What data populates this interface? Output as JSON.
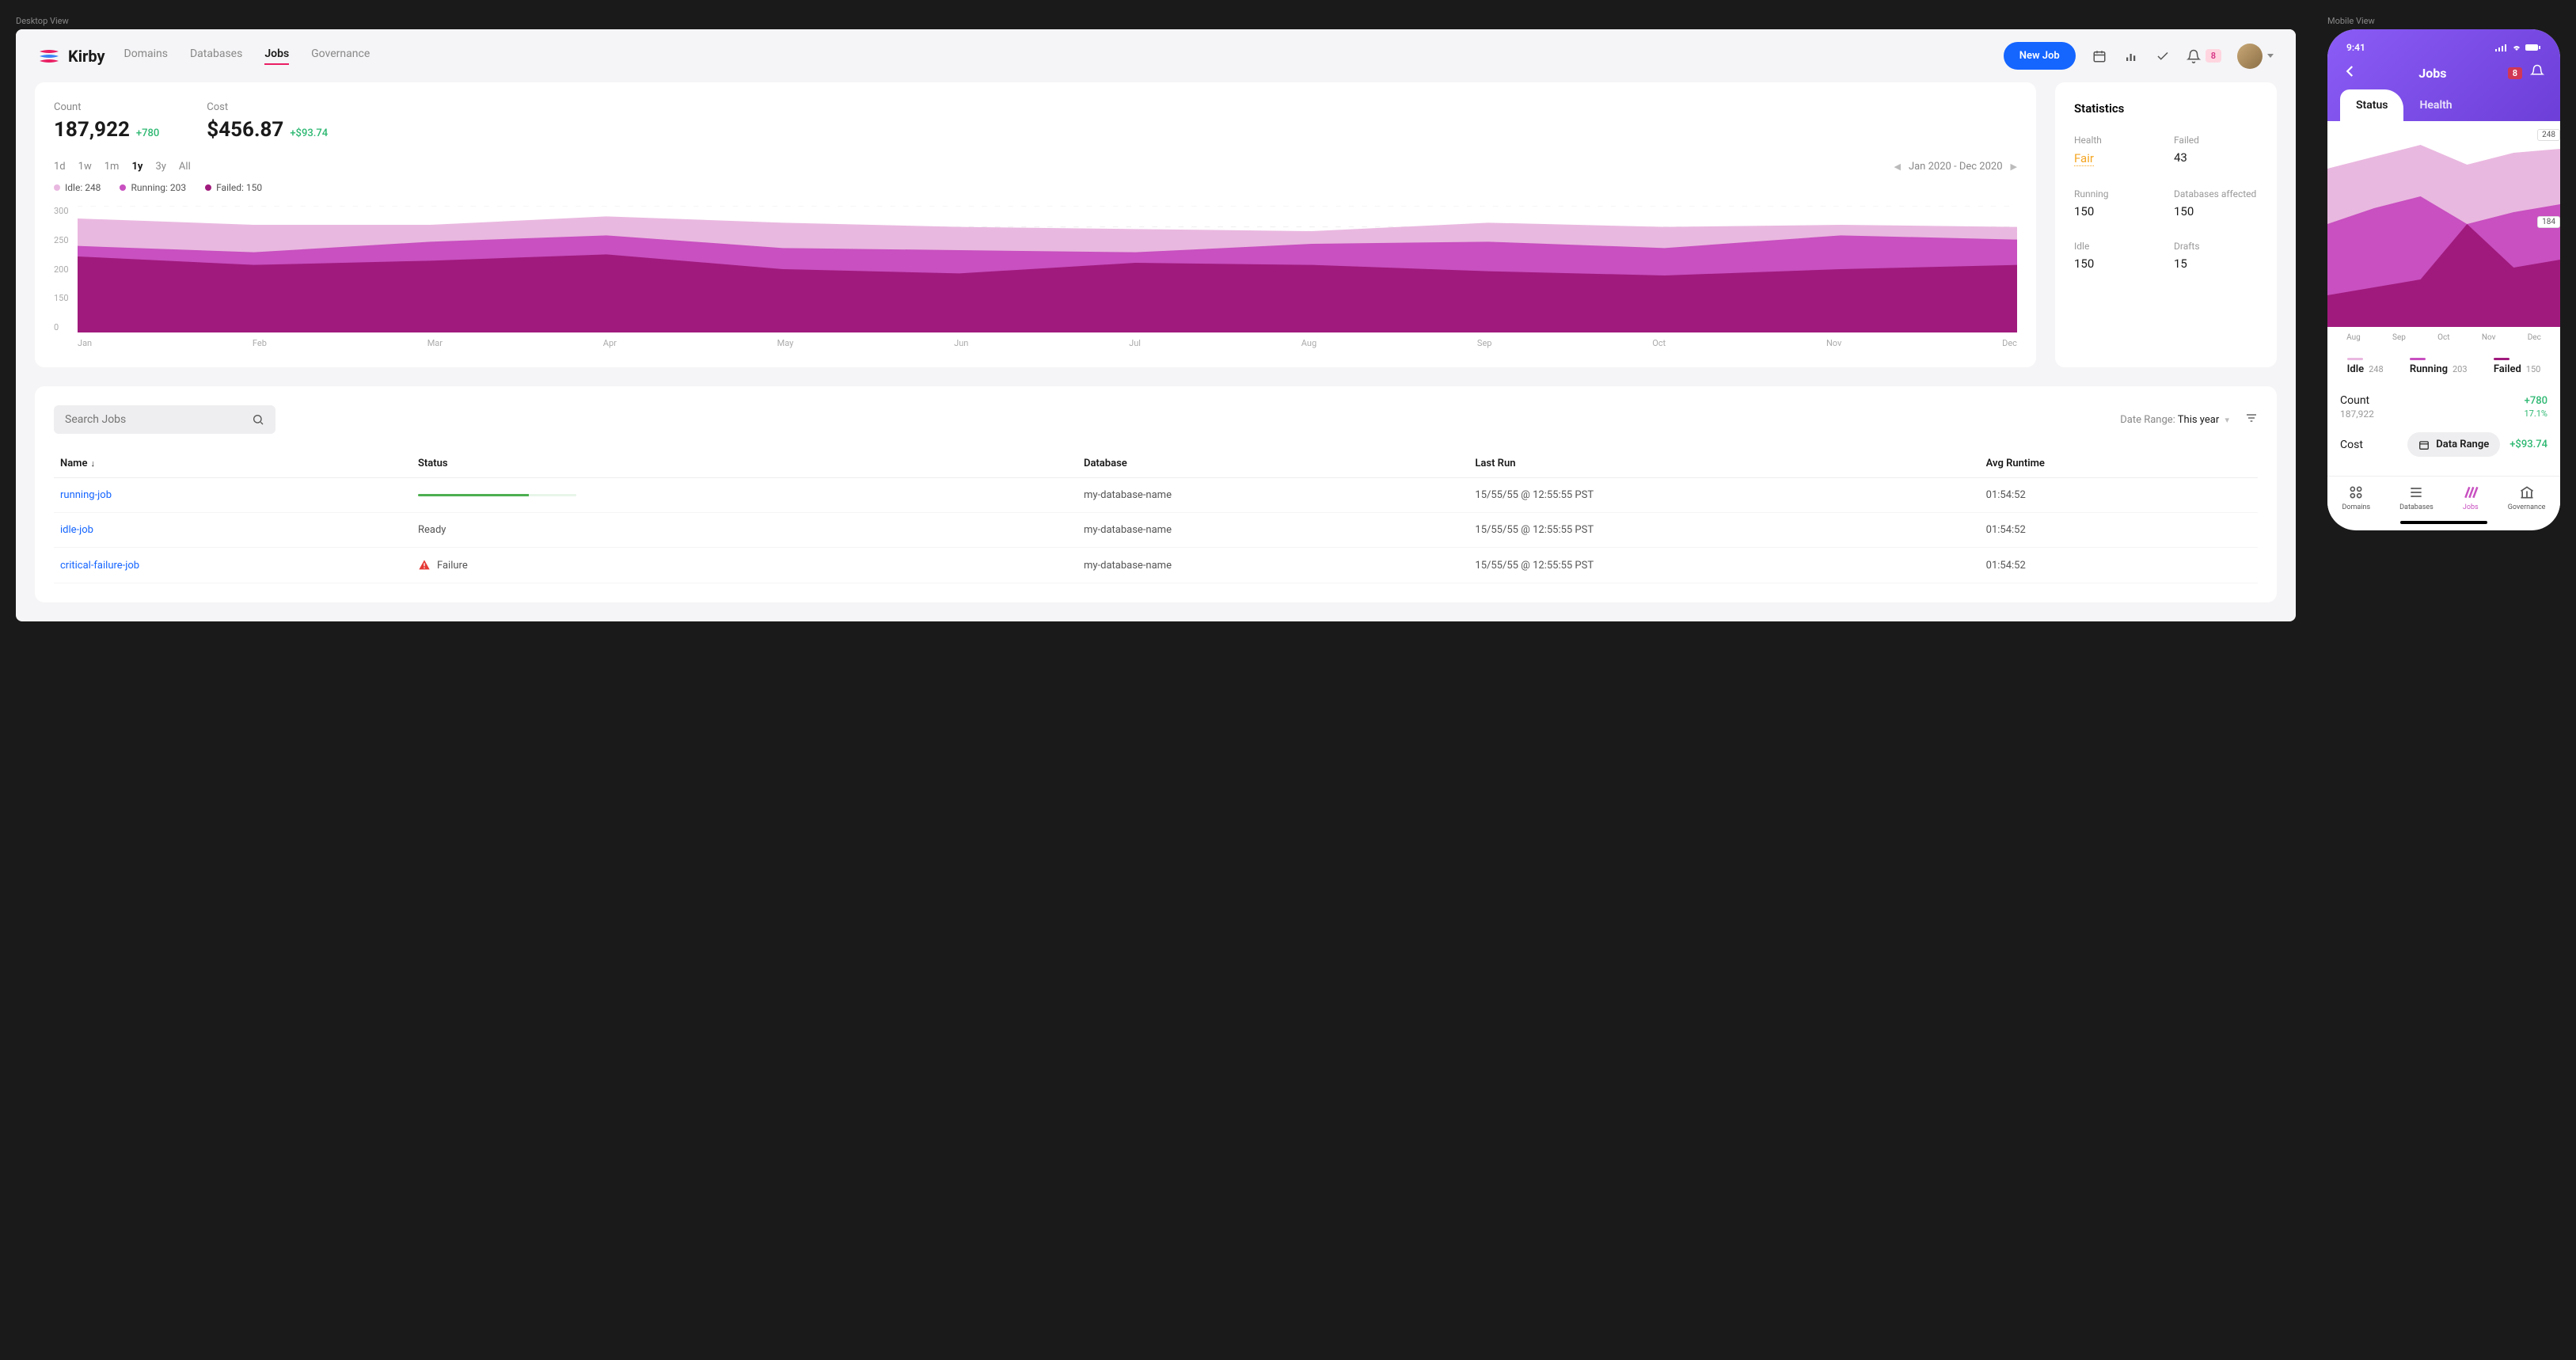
{
  "app": {
    "name": "Kirby"
  },
  "nav": {
    "items": [
      "Domains",
      "Databases",
      "Jobs",
      "Governance"
    ],
    "active": "Jobs",
    "new_job_label": "New Job",
    "notif_count": "8"
  },
  "metrics": {
    "count": {
      "label": "Count",
      "value": "187,922",
      "delta": "+780"
    },
    "cost": {
      "label": "Cost",
      "value": "$456.87",
      "delta": "+$93.74"
    }
  },
  "chart_controls": {
    "ranges": [
      "1d",
      "1w",
      "1m",
      "1y",
      "3y",
      "All"
    ],
    "active_range": "1y",
    "date_label": "Jan 2020 - Dec 2020"
  },
  "chart_data": {
    "type": "area",
    "title": "",
    "xlabel": "",
    "ylabel": "",
    "ylim": [
      0,
      300
    ],
    "y_ticks": [
      300,
      250,
      200,
      150,
      0
    ],
    "categories": [
      "Jan",
      "Feb",
      "Mar",
      "Apr",
      "May",
      "Jun",
      "Jul",
      "Aug",
      "Sep",
      "Oct",
      "Nov",
      "Dec"
    ],
    "series": [
      {
        "name": "Idle",
        "count": 248,
        "color": "#e9b8e0",
        "values": [
          270,
          255,
          255,
          275,
          260,
          250,
          245,
          240,
          260,
          250,
          255,
          250
        ]
      },
      {
        "name": "Running",
        "count": 203,
        "color": "#c850c0",
        "values": [
          205,
          190,
          215,
          230,
          200,
          195,
          190,
          210,
          215,
          200,
          230,
          220
        ]
      },
      {
        "name": "Failed",
        "count": 150,
        "color": "#a01a7d",
        "values": [
          180,
          160,
          170,
          185,
          150,
          140,
          165,
          160,
          145,
          135,
          150,
          160
        ]
      }
    ]
  },
  "stats": {
    "title": "Statistics",
    "items": [
      {
        "label": "Health",
        "value": "Fair",
        "accent": "fair"
      },
      {
        "label": "Failed",
        "value": "43"
      },
      {
        "label": "Running",
        "value": "150"
      },
      {
        "label": "Databases affected",
        "value": "150"
      },
      {
        "label": "Idle",
        "value": "150"
      },
      {
        "label": "Drafts",
        "value": "15"
      }
    ]
  },
  "table": {
    "search_placeholder": "Search Jobs",
    "date_range_label": "Date Range:",
    "date_range_value": "This year",
    "columns": [
      "Name",
      "Status",
      "Database",
      "Last Run",
      "Avg Runtime"
    ],
    "rows": [
      {
        "name": "running-job",
        "status_type": "progress",
        "status": "",
        "database": "my-database-name",
        "last_run": "15/55/55 @ 12:55:55 PST",
        "avg": "01:54:52"
      },
      {
        "name": "idle-job",
        "status_type": "text",
        "status": "Ready",
        "database": "my-database-name",
        "last_run": "15/55/55 @ 12:55:55 PST",
        "avg": "01:54:52"
      },
      {
        "name": "critical-failure-job",
        "status_type": "failure",
        "status": "Failure",
        "database": "my-database-name",
        "last_run": "15/55/55 @ 12:55:55 PST",
        "avg": "01:54:52"
      }
    ]
  },
  "mobile": {
    "time": "9:41",
    "title": "Jobs",
    "notif_count": "8",
    "tabs": {
      "a": "Status",
      "b": "Health"
    },
    "chart_labels": {
      "top": "248",
      "mid": "184"
    },
    "x_labels": [
      "Aug",
      "Sep",
      "Oct",
      "Nov",
      "Dec"
    ],
    "legend": [
      {
        "name": "Idle",
        "val": "248",
        "color": "#e9b8e0"
      },
      {
        "name": "Running",
        "val": "203",
        "color": "#c850c0"
      },
      {
        "name": "Failed",
        "val": "150",
        "color": "#a01a7d"
      }
    ],
    "metrics": {
      "count": {
        "label": "Count",
        "value": "187,922",
        "delta": "+780",
        "pct": "17.1%"
      },
      "cost": {
        "label": "Cost",
        "delta": "+$93.74"
      }
    },
    "data_range_label": "Data Range",
    "tabbar": [
      "Domains",
      "Databases",
      "Jobs",
      "Governance"
    ]
  },
  "view_labels": {
    "desktop": "Desktop View",
    "mobile": "Mobile View"
  }
}
